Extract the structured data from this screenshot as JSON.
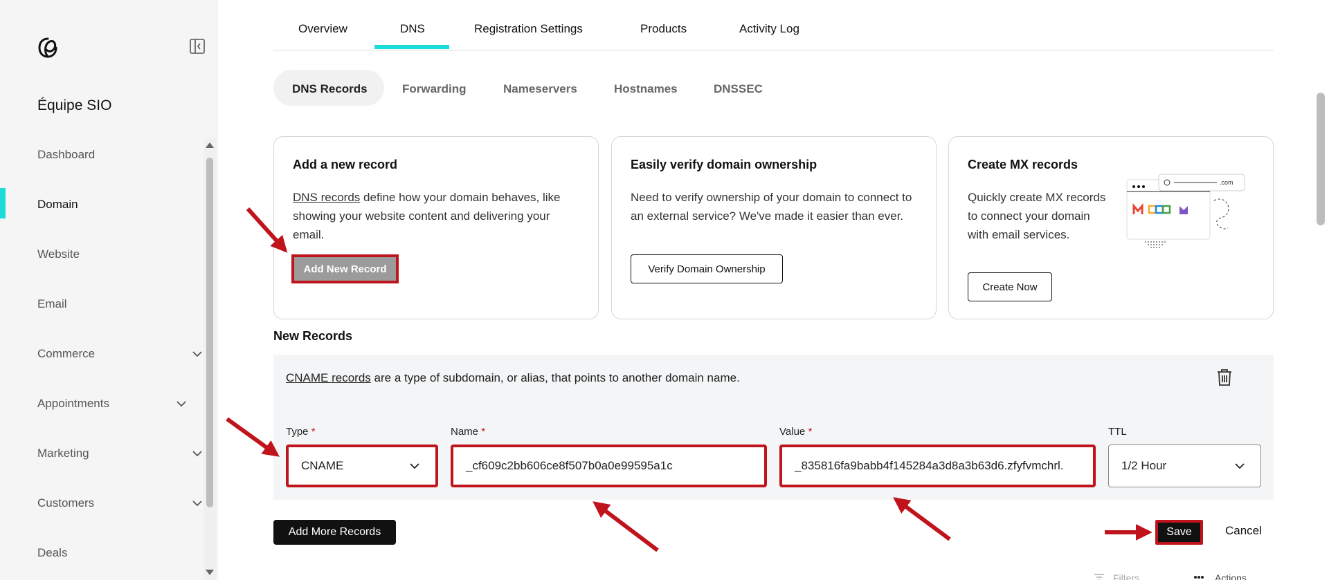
{
  "sidebar": {
    "org_name": "Équipe SIO",
    "items": [
      {
        "label": "Dashboard"
      },
      {
        "label": "Domain"
      },
      {
        "label": "Website"
      },
      {
        "label": "Email"
      },
      {
        "label": "Commerce"
      },
      {
        "label": "Appointments"
      },
      {
        "label": "Marketing"
      },
      {
        "label": "Customers"
      },
      {
        "label": "Deals"
      }
    ]
  },
  "tabs": [
    "Overview",
    "DNS",
    "Registration Settings",
    "Products",
    "Activity Log"
  ],
  "subtabs": [
    "DNS Records",
    "Forwarding",
    "Nameservers",
    "Hostnames",
    "DNSSEC"
  ],
  "cards": {
    "add": {
      "title": "Add a new record",
      "link": "DNS records",
      "desc_rest": " define how your domain behaves, like showing your website content and delivering your email.",
      "button": "Add New Record"
    },
    "verify": {
      "title": "Easily verify domain ownership",
      "desc": "Need to verify ownership of your domain to connect to an external service? We've made it easier than ever.",
      "button": "Verify Domain Ownership"
    },
    "mx": {
      "title": "Create MX records",
      "desc": "Quickly create MX records to connect your domain with email services.",
      "button": "Create Now",
      "illus_text": ".com"
    }
  },
  "new_records": {
    "title": "New Records",
    "desc_link": "CNAME records",
    "desc_rest": " are a type of subdomain, or alias, that points to another domain name.",
    "type_label": "Type",
    "name_label": "Name",
    "value_label": "Value",
    "ttl_label": "TTL",
    "required_mark": "*",
    "type_value": "CNAME",
    "name_value": "_cf609c2bb606ce8f507b0a0e99595a1c",
    "value_value": "_835816fa9babb4f145284a3d8a3b63d6.zfyfvmchrl.",
    "ttl_value": "1/2 Hour"
  },
  "actions": {
    "add_more": "Add More Records",
    "save": "Save",
    "cancel": "Cancel",
    "filters": "Filters",
    "more": "Actions"
  },
  "colors": {
    "accent": "#1bdbdb",
    "annotation": "#c0141c"
  }
}
